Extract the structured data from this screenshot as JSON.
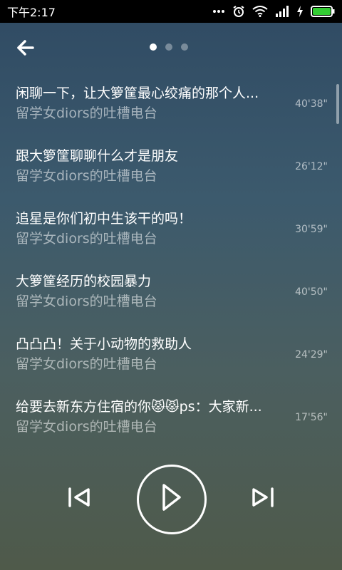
{
  "status_bar": {
    "time": "下午2:17",
    "icons": [
      "more-dots-icon",
      "alarm-icon",
      "wifi-icon",
      "signal-icon",
      "charging-icon",
      "battery-icon"
    ],
    "battery_color": "#33cc33"
  },
  "header": {
    "back_icon": "arrow-left-icon",
    "page_count": 3,
    "active_page": 1
  },
  "episodes": [
    {
      "title": "闲聊一下，让大箩筐最心绞痛的那个人...",
      "subtitle": "留学女diors的吐槽电台",
      "duration": "40'38\""
    },
    {
      "title": "跟大箩筐聊聊什么才是朋友",
      "subtitle": "留学女diors的吐槽电台",
      "duration": "26'12\""
    },
    {
      "title": "追星是你们初中生该干的吗！",
      "subtitle": "留学女diors的吐槽电台",
      "duration": "30'59\""
    },
    {
      "title": "大箩筐经历的校园暴力",
      "subtitle": "留学女diors的吐槽电台",
      "duration": "40'50\""
    },
    {
      "title": "凸凸凸！关于小动物的救助人",
      "subtitle": "留学女diors的吐槽电台",
      "duration": "24'29\""
    },
    {
      "title": "给要去新东方住宿的你😾😾ps：大家新...",
      "subtitle": "留学女diors的吐槽电台",
      "duration": "17'56\""
    }
  ],
  "controls": {
    "previous_icon": "skip-previous-icon",
    "play_icon": "play-icon",
    "next_icon": "skip-next-icon"
  }
}
